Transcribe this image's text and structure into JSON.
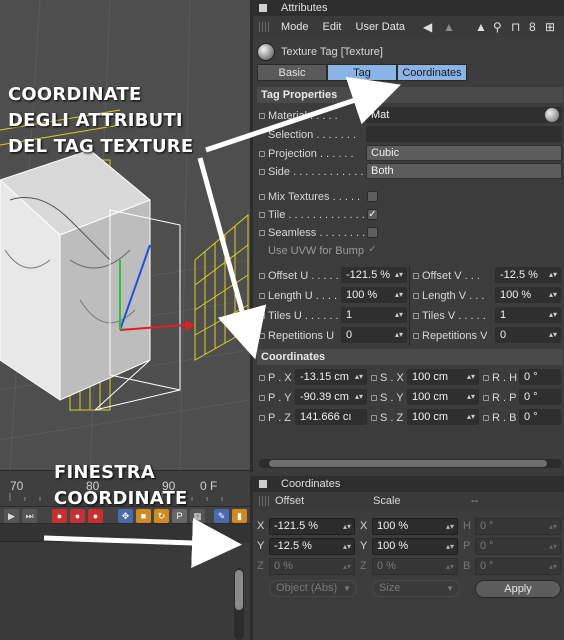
{
  "timeline": {
    "tick_70": "70",
    "tick_80": "80",
    "tick_90": "90",
    "frame": "0 F"
  },
  "attributes": {
    "title": "Attributes",
    "menu": [
      "Mode",
      "Edit",
      "User Data"
    ],
    "tag_title": "Texture Tag [Texture]",
    "tabs": [
      "Basic",
      "Tag",
      "Coordinates"
    ],
    "tag_properties": {
      "heading": "Tag Properties",
      "material_label": "Material",
      "material_value": "Mat",
      "selection_label": "Selection",
      "projection_label": "Projection",
      "projection_value": "Cubic",
      "side_label": "Side",
      "side_value": "Both",
      "mix_textures_label": "Mix Textures",
      "tile_label": "Tile",
      "seamless_label": "Seamless",
      "uvw_label": "Use UVW for Bump",
      "offset_u_label": "Offset U",
      "offset_u_value": "-121.5 %",
      "offset_v_label": "Offset V",
      "offset_v_value": "-12.5 %",
      "length_u_label": "Length U",
      "length_u_value": "100 %",
      "length_v_label": "Length V",
      "length_v_value": "100 %",
      "tiles_u_label": "Tiles U",
      "tiles_u_value": "1",
      "tiles_v_label": "Tiles V",
      "tiles_v_value": "1",
      "rep_u_label": "Repetitions U",
      "rep_u_value": "0",
      "rep_v_label": "Repetitions V",
      "rep_v_value": "0"
    },
    "coordinates": {
      "heading": "Coordinates",
      "px_label": "P . X",
      "px_value": "-13.15 cm",
      "py_label": "P . Y",
      "py_value": "-90.39 cm",
      "pz_label": "P . Z",
      "pz_value": "141.666 cı",
      "sx_label": "S . X",
      "sx_value": "100 cm",
      "sy_label": "S . Y",
      "sy_value": "100 cm",
      "sz_label": "S . Z",
      "sz_value": "100 cm",
      "rh_label": "R . H",
      "rh_value": "0 °",
      "rp_label": "R . P",
      "rp_value": "0 °",
      "rb_label": "R . B",
      "rb_value": "0 °"
    }
  },
  "coordinates_panel": {
    "title": "Coordinates",
    "col_offset": "Offset",
    "col_scale": "Scale",
    "col_third": "--",
    "x_label": "X",
    "x_offset": "-121.5 %",
    "x_scale_label": "X",
    "x_scale": "100 %",
    "h_label": "H",
    "h_value": "0 °",
    "y_label": "Y",
    "y_offset": "-12.5 %",
    "y_scale_label": "Y",
    "y_scale": "100 %",
    "p_label": "P",
    "p_value": "0 °",
    "z_label": "Z",
    "z_offset": "0 %",
    "z_scale_label": "Z",
    "z_scale": "0 %",
    "b_label": "B",
    "b_value": "0 °",
    "mode_dropdown": "Object (Abs)",
    "size_dropdown": "Size",
    "apply_label": "Apply"
  },
  "annotations": {
    "tag_coords_line1": "COORDINATE",
    "tag_coords_line2": "DEGLI ATTRIBUTI",
    "tag_coords_line3": "DEL TAG TEXTURE",
    "window_line1": "FINESTRA",
    "window_line2": "COORDINATE"
  },
  "colors": {
    "accent_tab": "#8ab4e6",
    "annotation_text": "#ffffff",
    "arrow": "#ffffff"
  }
}
